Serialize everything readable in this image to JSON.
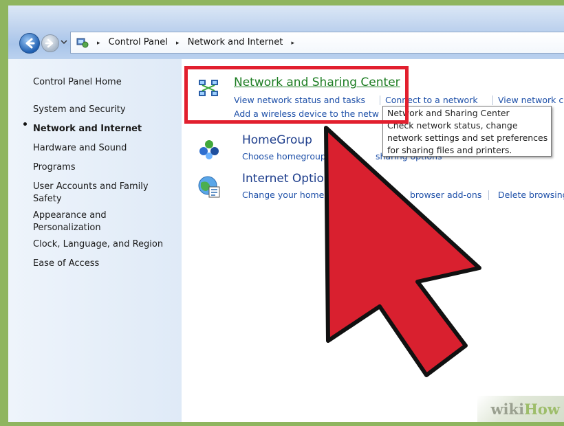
{
  "window": {
    "address_bar": {
      "icon": "control-panel-icon",
      "crumbs": [
        "Control Panel",
        "Network and Internet"
      ],
      "separator": "▸"
    }
  },
  "sidebar": {
    "items": [
      {
        "label": "Control Panel Home",
        "active": false
      },
      {
        "label": "System and Security",
        "active": false
      },
      {
        "label": "Network and Internet",
        "active": true
      },
      {
        "label": "Hardware and Sound",
        "active": false
      },
      {
        "label": "Programs",
        "active": false
      },
      {
        "label": "User Accounts and Family Safety",
        "active": false
      },
      {
        "label": "Appearance and Personalization",
        "active": false
      },
      {
        "label": "Clock, Language, and Region",
        "active": false
      },
      {
        "label": "Ease of Access",
        "active": false
      }
    ]
  },
  "categories": [
    {
      "title": "Network and Sharing Center",
      "icon": "network-sharing-icon",
      "links": [
        "View network status and tasks",
        "Connect to a network",
        "View network c",
        "Add a wireless device to the netw"
      ]
    },
    {
      "title": "HomeGroup",
      "icon": "homegroup-icon",
      "links": [
        "Choose homegroup",
        "sharing options"
      ]
    },
    {
      "title": "Internet Option",
      "icon": "internet-options-icon",
      "links": [
        "Change your home",
        "browser add-ons",
        "Delete browsing"
      ]
    }
  ],
  "tooltip": {
    "line1": "Network and Sharing Center",
    "line2": "Check network status, change",
    "line3": "network settings and set preferences",
    "line4": "for sharing files and printers."
  },
  "watermark": {
    "part1": "wiki",
    "part2": "How"
  },
  "colors": {
    "highlight_box": "#e21f2e",
    "arrow": "#d9202f",
    "link_blue": "#1d4fa8",
    "category_title": "#1e3e8c",
    "hover_title_green": "#1c7d22",
    "outer_background": "#8fb55f"
  }
}
